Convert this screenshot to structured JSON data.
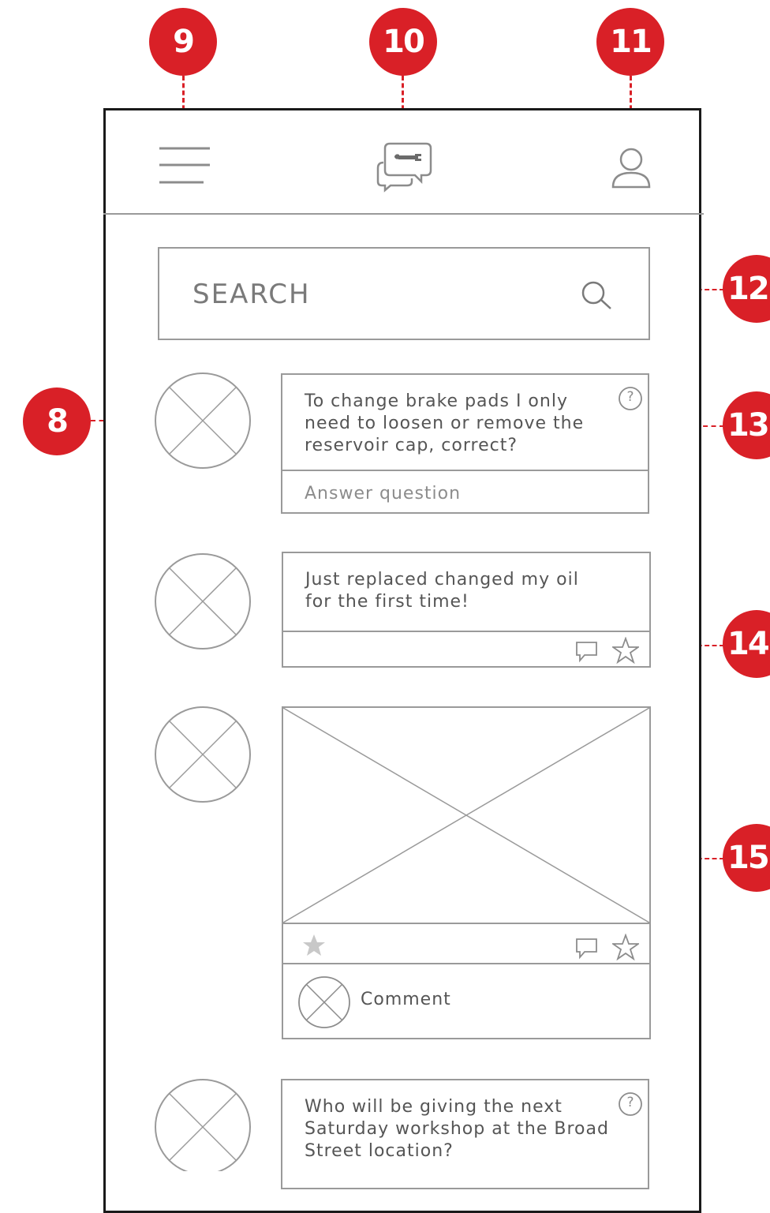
{
  "callouts": {
    "c8": "8",
    "c9": "9",
    "c10": "10",
    "c11": "11",
    "c12": "12",
    "c13": "13",
    "c14": "14",
    "c15": "15"
  },
  "header": {
    "menu_icon": "hamburger-icon",
    "logo_icon": "wrench-chat-logo-icon",
    "profile_icon": "user-icon"
  },
  "search": {
    "placeholder": "SEARCH",
    "icon": "search-icon"
  },
  "feed": {
    "post1": {
      "text": "To change brake pads I only\nneed to loosen or remove the\nreservoir cap, correct?",
      "badge": "?",
      "answer_label": "Answer question"
    },
    "post2": {
      "text": "Just replaced changed my oil\nfor the first time!"
    },
    "post3": {
      "comment_label": "Comment"
    },
    "post4": {
      "text": "Who will be giving the next\nSaturday workshop at the Broad\nStreet location?",
      "badge": "?"
    }
  },
  "colors": {
    "accent": "#d92027",
    "wire": "#9a9a9a"
  }
}
